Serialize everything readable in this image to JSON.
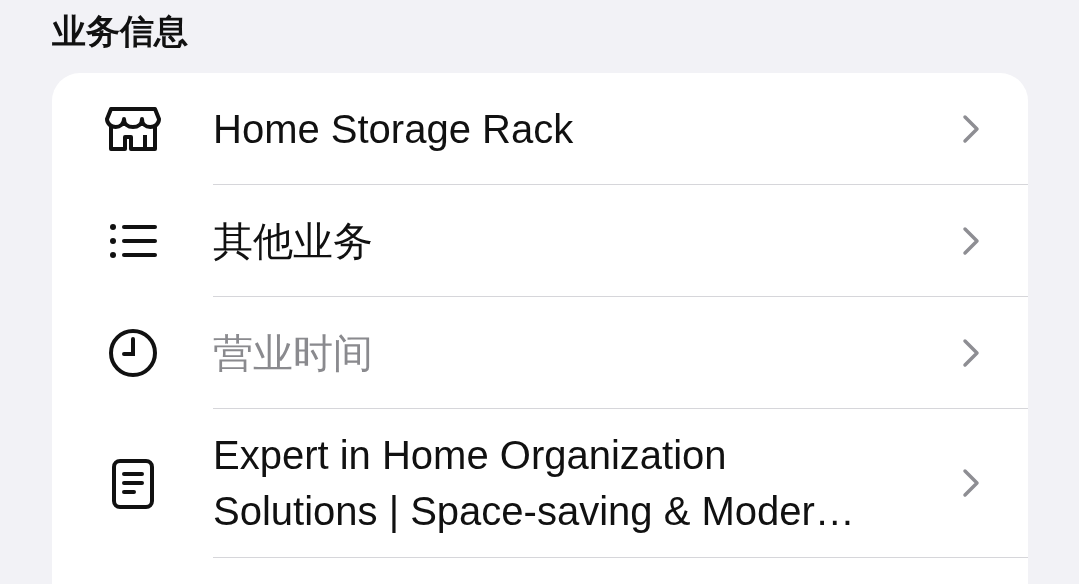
{
  "section_title": "业务信息",
  "items": [
    {
      "kind": "store",
      "label": "Home Storage Rack",
      "muted": false
    },
    {
      "kind": "list",
      "label": "其他业务",
      "muted": false
    },
    {
      "kind": "clock",
      "label": "营业时间",
      "muted": true
    },
    {
      "kind": "note",
      "label": "Expert in Home Organization Solutions | Space-saving & Moder…",
      "muted": false
    }
  ]
}
